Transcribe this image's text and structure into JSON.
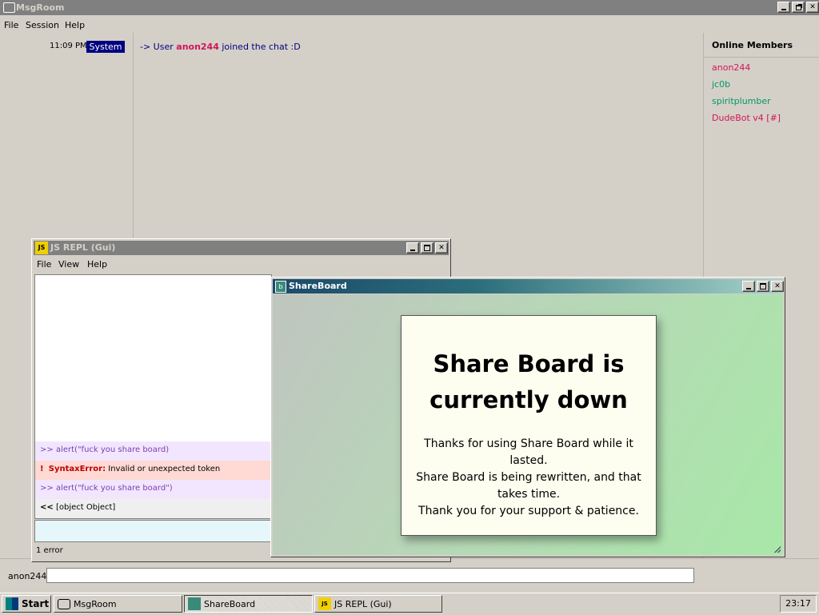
{
  "msgroom": {
    "title": "MsgRoom",
    "menu": [
      "File",
      "Session",
      "Help"
    ],
    "messages": [
      {
        "time": "11:09 PM",
        "author": "System",
        "prefix": "-> User ",
        "user": "anon244",
        "suffix": " joined the chat :D"
      }
    ],
    "members_title": "Online Members",
    "members": [
      {
        "name": "anon244",
        "color": "#d4145a"
      },
      {
        "name": "jc0b",
        "color": "#009966"
      },
      {
        "name": "spiritplumber",
        "color": "#009966"
      },
      {
        "name": "DudeBot v4 [#]",
        "color": "#d4145a"
      }
    ],
    "input_username": "anon244",
    "input_value": ""
  },
  "repl": {
    "icon": "JS",
    "title": "JS REPL (Gui)",
    "menu": [
      "File",
      "View",
      "Help"
    ],
    "lines": [
      {
        "kind": "input",
        "marker": ">>",
        "text": "alert(\"fuck you share board)"
      },
      {
        "kind": "error",
        "marker": "!",
        "label": "SyntaxError:",
        "text": "Invalid or unexpected token"
      },
      {
        "kind": "input",
        "marker": ">>",
        "text": "alert(\"fuck you share board\")"
      },
      {
        "kind": "output",
        "marker": "<<",
        "text": "[object Object]"
      }
    ],
    "status": "1 error"
  },
  "shareboard": {
    "title": "ShareBoard",
    "heading": "Share Board is currently down",
    "message_lines": [
      "Thanks for using Share Board while it lasted.",
      "Share Board is being rewritten, and that takes time.",
      "Thank you for your support & patience."
    ]
  },
  "taskbar": {
    "start_label": "Start",
    "buttons": [
      {
        "label": "MsgRoom",
        "icon": "chat-icon"
      },
      {
        "label": "ShareBoard",
        "icon": "shareboard-icon"
      },
      {
        "label": "JS REPL (Gui)",
        "icon": "js-icon"
      }
    ],
    "clock": "23:17"
  },
  "colors": {
    "system_badge_bg": "#000080",
    "user_highlight": "#d4145a",
    "system_text": "#000080"
  }
}
